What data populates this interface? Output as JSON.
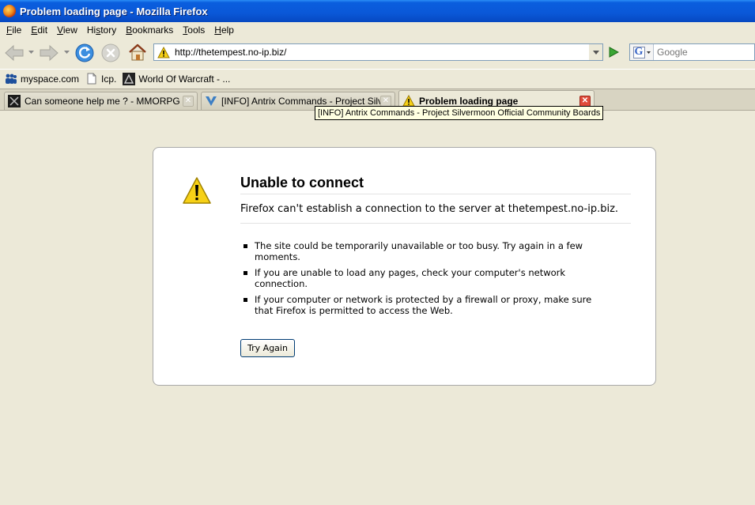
{
  "window": {
    "title": "Problem loading page - Mozilla Firefox"
  },
  "menu": [
    {
      "acc": "F",
      "rest": "ile"
    },
    {
      "acc": "E",
      "rest": "dit"
    },
    {
      "acc": "V",
      "rest": "iew"
    },
    {
      "acc": "",
      "rest": "History",
      "accInner": "s"
    },
    {
      "acc": "B",
      "rest": "ookmarks"
    },
    {
      "acc": "T",
      "rest": "ools"
    },
    {
      "acc": "H",
      "rest": "elp"
    }
  ],
  "menu_labels": [
    "File",
    "Edit",
    "View",
    "History",
    "Bookmarks",
    "Tools",
    "Help"
  ],
  "toolbar": {
    "url": "http://thetempest.no-ip.biz/",
    "search_placeholder": "Google",
    "search_engine": "G"
  },
  "bookmarks": [
    {
      "label": "myspace.com",
      "icon": "myspace-icon"
    },
    {
      "label": "Icp.",
      "icon": "page-icon"
    },
    {
      "label": "World Of Warcraft - ...",
      "icon": "wow-icon"
    }
  ],
  "tabs": [
    {
      "label": "Can someone help me ? - MMORPG De...",
      "icon": "forum-icon",
      "active": false
    },
    {
      "label": "[INFO] Antrix Commands - Project Silv...",
      "icon": "silvermoon-icon",
      "active": false
    },
    {
      "label": "Problem loading page",
      "icon": "warning-icon",
      "active": true
    }
  ],
  "tooltip": "[INFO] Antrix Commands - Project Silvermoon Official Community Boards",
  "error": {
    "title": "Unable to connect",
    "description": "Firefox can't establish a connection to the server at thetempest.no-ip.biz.",
    "items": [
      "The site could be temporarily unavailable or too busy. Try again in a few moments.",
      "If you are unable to load any pages, check your computer's network connection.",
      "If your computer or network is protected by a firewall or proxy, make sure that Firefox is permitted to access the Web."
    ],
    "button": "Try Again"
  },
  "colors": {
    "titlebar": "#0a5ede",
    "background": "#ece9d8",
    "warning": "#f7d117"
  }
}
